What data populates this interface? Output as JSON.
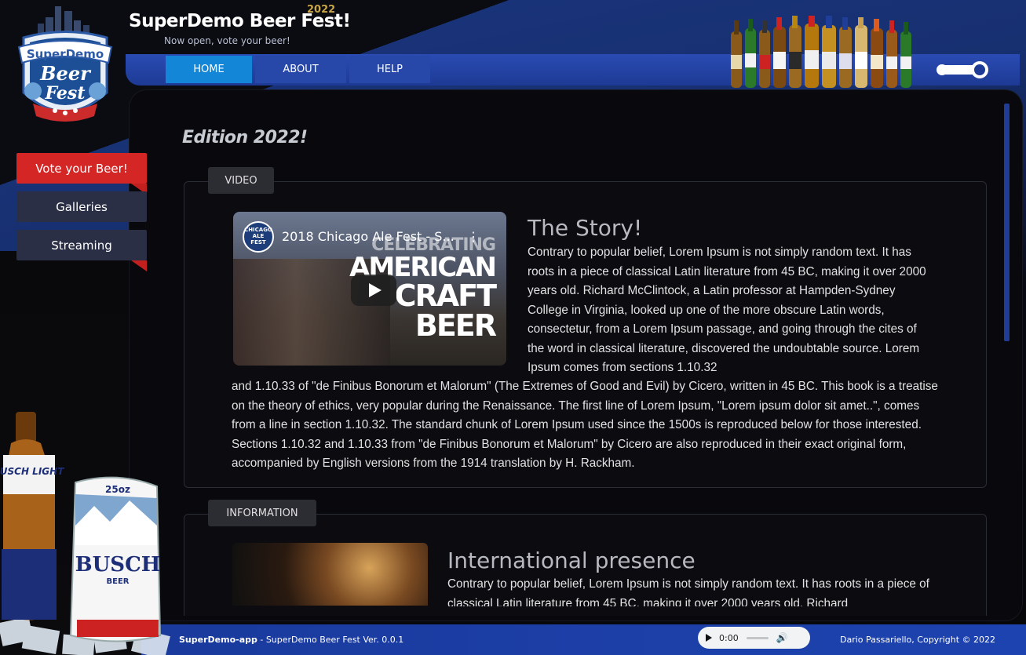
{
  "header": {
    "title": "SuperDemo Beer Fest!",
    "year_badge": "2022",
    "subtitle": "Now open, vote your beer!"
  },
  "logo": {
    "line1": "SuperDemo",
    "line2": "Beer",
    "line3": "Fest"
  },
  "nav": {
    "tabs": [
      {
        "label": "HOME",
        "active": true
      },
      {
        "label": "ABOUT",
        "active": false
      },
      {
        "label": "HELP",
        "active": false
      }
    ]
  },
  "sidebar": {
    "items": [
      {
        "label": "Vote your Beer!",
        "style": "primary"
      },
      {
        "label": "Galleries",
        "style": "default"
      },
      {
        "label": "Streaming",
        "style": "default"
      }
    ]
  },
  "main": {
    "edition_title": "Edition 2022!",
    "video_section": {
      "label": "VIDEO",
      "video": {
        "title": "2018 Chicago Ale Fest - S...",
        "channel_badge": "CHICAGO ALE FEST",
        "overlay_line1": "CELEBRATING",
        "overlay_line2": "AMERICAN",
        "overlay_line3": "CRAFT",
        "overlay_line4": "BEER"
      },
      "heading": "The Story!",
      "text_part1": "Contrary to popular belief, Lorem Ipsum is not simply random text. It has roots in a piece of classical Latin literature from 45 BC, making it over 2000 years old. Richard McClintock, a Latin professor at Hampden-Sydney College in Virginia, looked up one of the more obscure Latin words, consectetur, from a Lorem Ipsum passage, and going through the cites of the word in classical literature, discovered the undoubtable source. Lorem Ipsum comes from sections 1.10.32",
      "text_part2": "and 1.10.33 of \"de Finibus Bonorum et Malorum\" (The Extremes of Good and Evil) by Cicero, written in 45 BC. This book is a treatise on the theory of ethics, very popular during the Renaissance. The first line of Lorem Ipsum, \"Lorem ipsum dolor sit amet..\", comes from a line in section 1.10.32. The standard chunk of Lorem Ipsum used since the 1500s is reproduced below for those interested. Sections 1.10.32 and 1.10.33 from \"de Finibus Bonorum et Malorum\" by Cicero are also reproduced in their exact original form, accompanied by English versions from the 1914 translation by H. Rackham."
    },
    "info_section": {
      "label": "INFORMATION",
      "heading": "International presence",
      "text": "Contrary to popular belief, Lorem Ipsum is not simply random text. It has roots in a piece of classical Latin literature from 45 BC, making it over 2000 years old. Richard"
    }
  },
  "beer_art": {
    "bottle_label": "BUSCH LIGHT",
    "can_label": "BUSCH",
    "can_sub": "BEER",
    "can_size": "25oz"
  },
  "footer": {
    "app_name": "SuperDemo-app",
    "version_text": " - SuperDemo Beer Fest Ver. 0.0.1",
    "copyright": "Dario Passariello, Copyright © 2022",
    "audio_time": "0:00"
  },
  "colors": {
    "nav_blue": "#2748a8",
    "nav_active": "#1486d8",
    "vote_red": "#d52626",
    "footer_blue": "#1d43b0"
  }
}
